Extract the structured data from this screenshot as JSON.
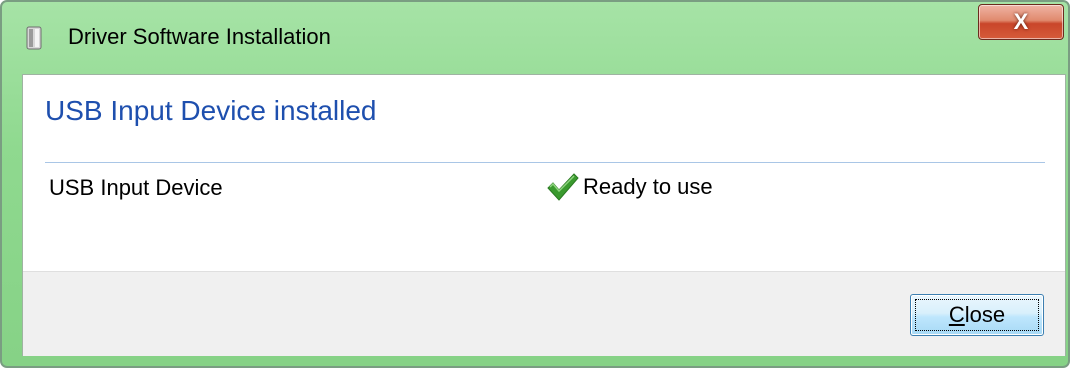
{
  "window": {
    "title": "Driver Software Installation",
    "close_glyph": "X",
    "title_icon": "usb-device-icon"
  },
  "content": {
    "heading": "USB Input Device installed",
    "devices": [
      {
        "name": "USB Input Device",
        "status_icon": "checkmark-icon",
        "status": "Ready to use"
      }
    ]
  },
  "footer": {
    "close_mnemonic": "C",
    "close_rest": "lose"
  },
  "colors": {
    "title_bar": "#8fd98f",
    "heading": "#1e4fae",
    "check": "#3a9a2e",
    "footer_bg": "#f0f0f0"
  }
}
